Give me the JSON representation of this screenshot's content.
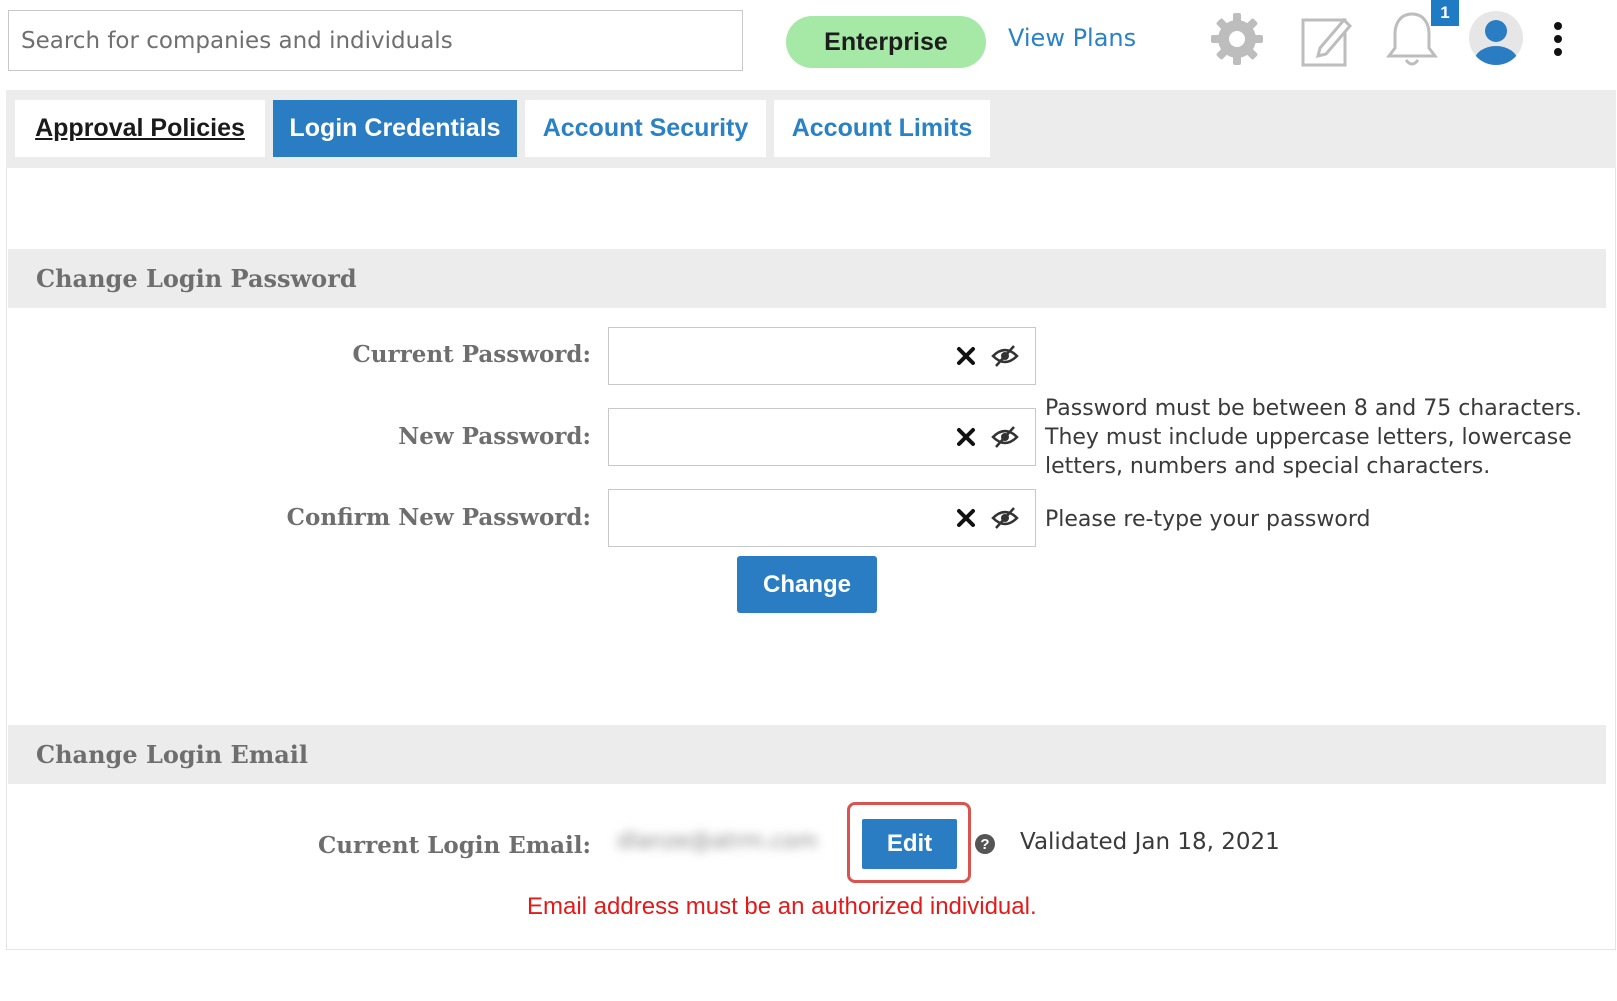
{
  "header": {
    "search_placeholder": "Search for companies and individuals",
    "plan_label": "Enterprise",
    "view_plans_label": "View Plans",
    "notification_count": "1",
    "icons": [
      "gear-icon",
      "edit-document-icon",
      "bell-icon",
      "user-avatar-icon",
      "more-vertical-icon"
    ]
  },
  "tabs": [
    {
      "label": "Approval Policies",
      "active": false
    },
    {
      "label": "Login Credentials",
      "active": true
    },
    {
      "label": "Account Security",
      "active": false
    },
    {
      "label": "Account Limits",
      "active": false
    }
  ],
  "password_section": {
    "title": "Change Login Password",
    "current_label": "Current Password:",
    "new_label": "New Password:",
    "confirm_label": "Confirm New Password:",
    "current_value": "",
    "new_value": "",
    "confirm_value": "",
    "rules_hint": [
      "Password must be between 8 and 75 characters.",
      "They must include uppercase letters, lowercase",
      "letters, numbers and special characters."
    ],
    "confirm_hint": "Please re-type your password",
    "change_button": "Change"
  },
  "email_section": {
    "title": "Change Login Email",
    "current_label": "Current Login Email:",
    "email_value": "dlanze@atrm.com",
    "edit_button": "Edit",
    "validated_text": "Validated Jan 18, 2021",
    "error_text": "Email address must be an authorized individual."
  },
  "colors": {
    "primary_blue": "#2a7dc2",
    "link_blue": "#2a82c4",
    "plan_green": "#a6e8a6",
    "error_red": "#e31a1a",
    "highlight_red": "#d9534f",
    "section_gray": "#ececec"
  }
}
